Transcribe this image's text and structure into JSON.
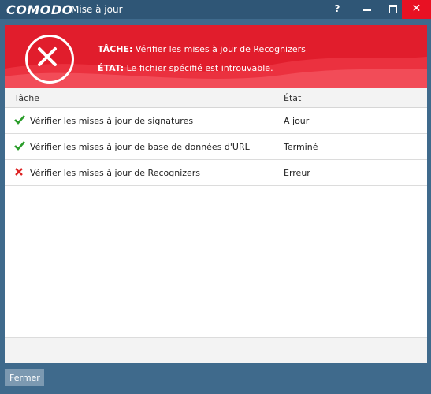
{
  "window": {
    "brand": "COMODO",
    "title": "Mise à jour",
    "help_label": "?",
    "close_label": "✕"
  },
  "banner": {
    "task_label": "TÂCHE:",
    "task_value": " Vérifier les mises à jour de Recognizers",
    "state_label": "ÉTAT:",
    "state_value": " Le fichier spécifié est introuvable."
  },
  "table": {
    "headers": {
      "task": "Tâche",
      "state": "État"
    },
    "rows": [
      {
        "status_icon": "check-icon",
        "task": "Vérifier les mises à jour de signatures",
        "state": "A jour"
      },
      {
        "status_icon": "check-icon",
        "task": "Vérifier les mises à jour de base de données d'URL",
        "state": "Terminé"
      },
      {
        "status_icon": "x-icon",
        "task": "Vérifier les mises à jour de Recognizers",
        "state": "Erreur"
      }
    ]
  },
  "footer": {
    "close_button": "Fermer"
  },
  "colors": {
    "accent_red": "#e11d2c",
    "title_bar": "#2f5676",
    "success": "#2a9d2a",
    "error": "#d22"
  }
}
